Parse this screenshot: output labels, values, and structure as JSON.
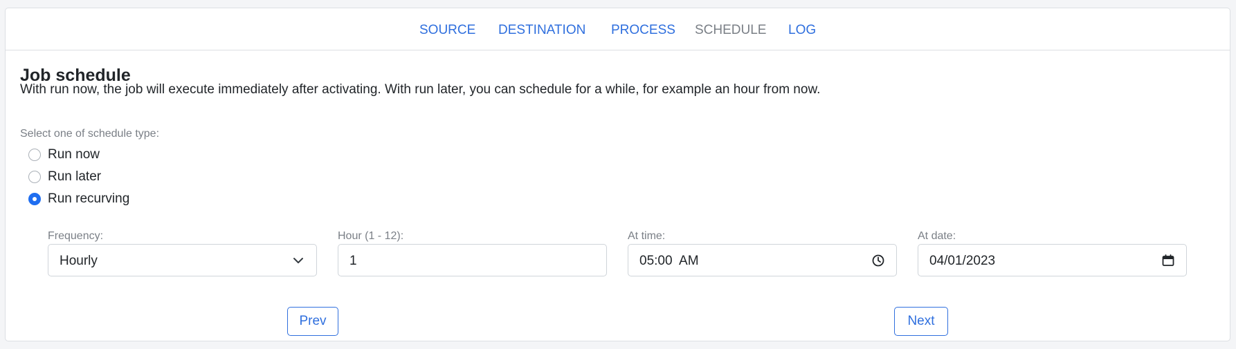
{
  "nav": {
    "tabs": [
      {
        "label": "SOURCE",
        "active": false
      },
      {
        "label": "DESTINATION",
        "active": false
      },
      {
        "label": "PROCESS",
        "active": false
      },
      {
        "label": "SCHEDULE",
        "active": true
      },
      {
        "label": "LOG",
        "active": false
      }
    ]
  },
  "header": {
    "title": "Job schedule",
    "description": "With run now, the job will execute immediately after activating. With run later, you can schedule for a while, for example an hour from now."
  },
  "schedule_type": {
    "label": "Select one of schedule type:",
    "options": [
      {
        "label": "Run now",
        "checked": false
      },
      {
        "label": "Run later",
        "checked": false
      },
      {
        "label": "Run recurving",
        "checked": true
      }
    ]
  },
  "fields": {
    "frequency": {
      "label": "Frequency:",
      "value": "Hourly",
      "icon": "chevron-down-icon"
    },
    "hour": {
      "label": "Hour (1 - 12):",
      "value": "1"
    },
    "time": {
      "label": "At time:",
      "value": "05:00  AM",
      "icon": "clock-icon"
    },
    "date": {
      "label": "At date:",
      "value": "04/01/2023",
      "icon": "calendar-icon"
    }
  },
  "buttons": {
    "prev": "Prev",
    "next": "Next"
  },
  "colors": {
    "accent": "#1f6ef0",
    "link": "#2f6fde",
    "muted": "#7a7f86",
    "text": "#212529",
    "background": "#f4f5f7"
  }
}
